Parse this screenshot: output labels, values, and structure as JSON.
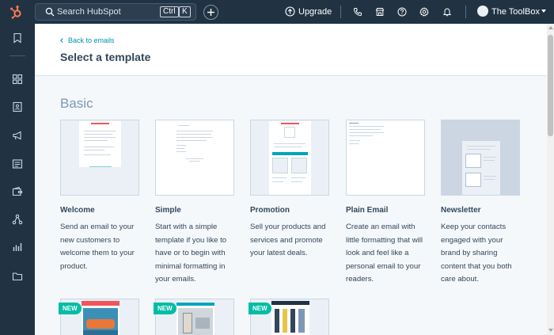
{
  "topbar": {
    "search_placeholder": "Search HubSpot",
    "shortcut_ctrl": "Ctrl",
    "shortcut_k": "K",
    "upgrade_label": "Upgrade",
    "account_name": "The ToolBox"
  },
  "header": {
    "back_label": "Back to emails",
    "title": "Select a template"
  },
  "section_title": "Basic",
  "templates": [
    {
      "name": "Welcome",
      "description": "Send an email to your new customers to welcome them to your product."
    },
    {
      "name": "Simple",
      "description": "Start with a simple template if you like to have or to begin with minimal formatting in your emails."
    },
    {
      "name": "Promotion",
      "description": "Sell your products and services and promote your latest deals."
    },
    {
      "name": "Plain Email",
      "description": "Create an email with little formatting that will look and feel like a personal email to your readers."
    },
    {
      "name": "Newsletter",
      "description": "Keep your contacts engaged with your brand by sharing content that you both care about."
    }
  ],
  "badges": [
    "NEW",
    "NEW",
    "NEW"
  ],
  "colors": {
    "nav_bg": "#213343",
    "accent": "#0091ae",
    "badge": "#00bda5",
    "text": "#33475b",
    "logo": "#ff7a59"
  }
}
